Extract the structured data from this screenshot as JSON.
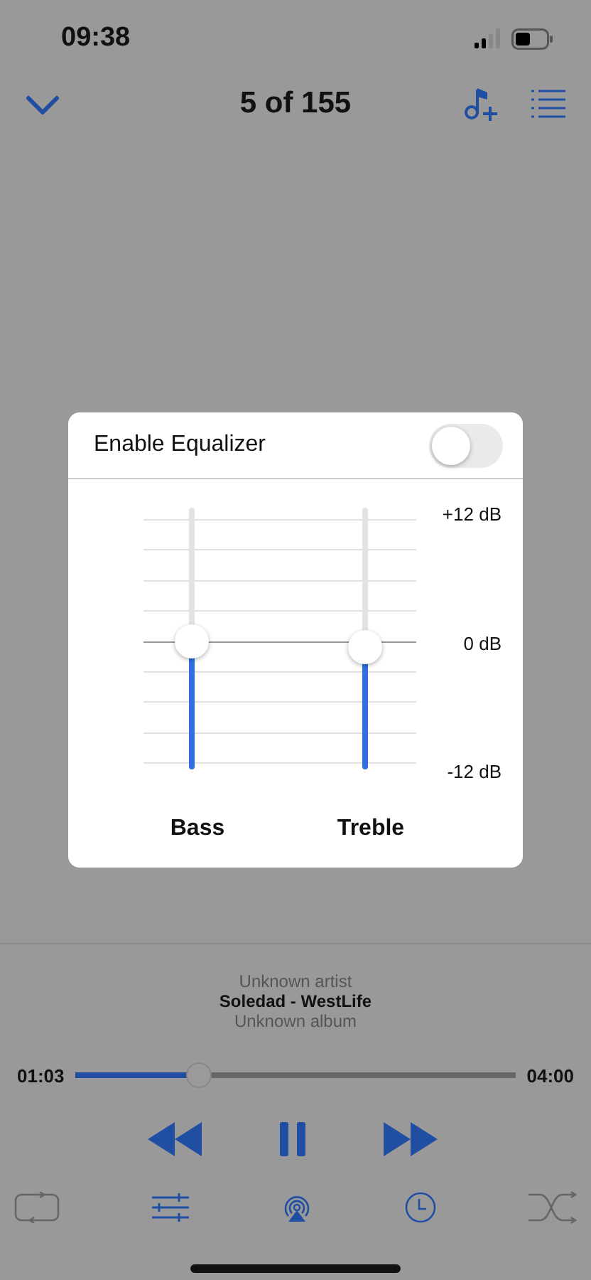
{
  "status_bar": {
    "time": "09:38"
  },
  "nav": {
    "title": "5 of 155"
  },
  "equalizer": {
    "title": "Enable Equalizer",
    "enabled": false,
    "scale": [
      "+12 dB",
      "0 dB",
      "-12 dB"
    ],
    "bands": [
      {
        "label": "Bass",
        "level": 0.49
      },
      {
        "label": "Treble",
        "level": 0.47
      }
    ]
  },
  "now_playing": {
    "artist": "Unknown artist",
    "title": "Soledad - WestLife",
    "album": "Unknown album",
    "elapsed": "01:03",
    "total": "04:00",
    "level": 0.28,
    "playing": true
  },
  "toggles": {
    "repeat": false,
    "shuffle": false
  }
}
